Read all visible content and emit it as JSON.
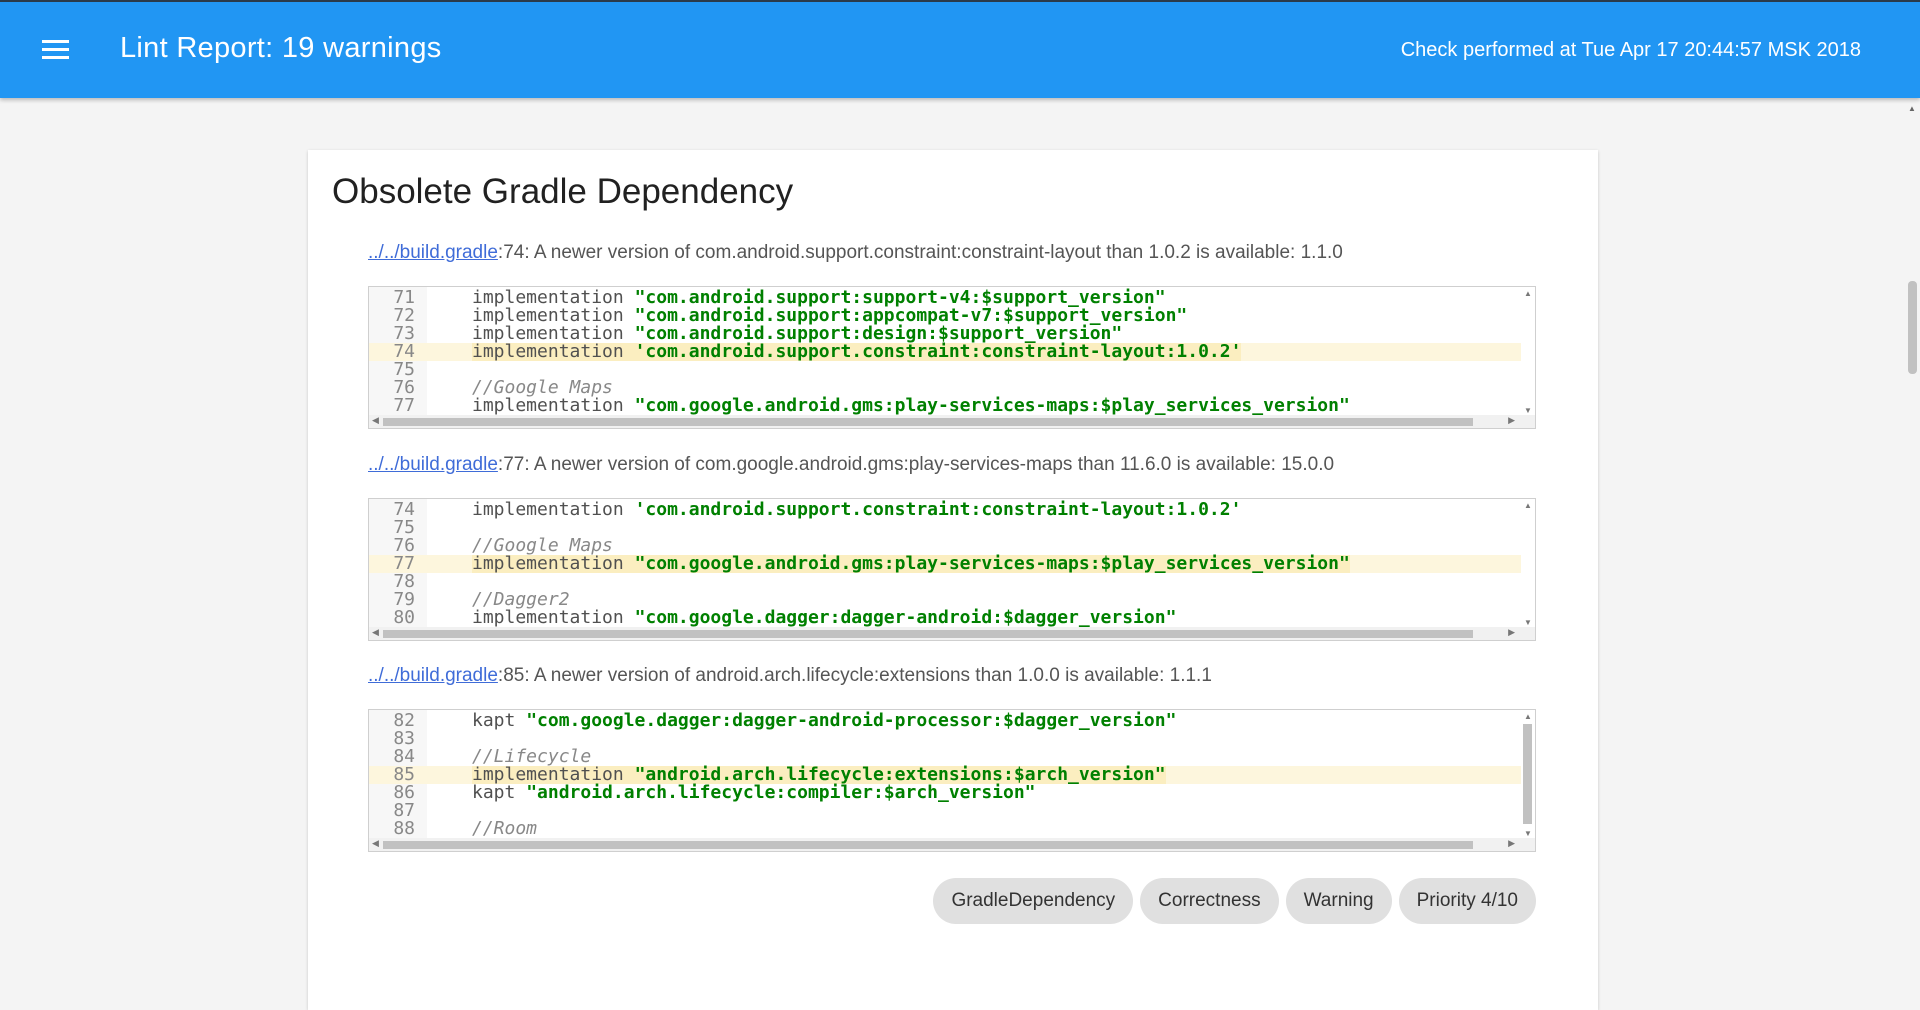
{
  "header": {
    "title": "Lint Report: 19 warnings",
    "check_time": "Check performed at Tue Apr 17 20:44:57 MSK 2018"
  },
  "issue": {
    "title": "Obsolete Gradle Dependency",
    "warnings": [
      {
        "file": "../../build.gradle",
        "message": ":74: A newer version of com.android.support.constraint:constraint-layout than 1.0.2 is available: 1.1.0",
        "lines": [
          {
            "num": "71",
            "hl": false,
            "kw": "implementation ",
            "str": "\"com.android.support:support-v4:$support_version\"",
            "cmt": ""
          },
          {
            "num": "72",
            "hl": false,
            "kw": "implementation ",
            "str": "\"com.android.support:appcompat-v7:$support_version\"",
            "cmt": ""
          },
          {
            "num": "73",
            "hl": false,
            "kw": "implementation ",
            "str": "\"com.android.support:design:$support_version\"",
            "cmt": ""
          },
          {
            "num": "74",
            "hl": true,
            "kw": "implementation ",
            "str": "'com.android.support.constraint:constraint-layout:1.0.2'",
            "cmt": ""
          },
          {
            "num": "75",
            "hl": false,
            "kw": "",
            "str": "",
            "cmt": ""
          },
          {
            "num": "76",
            "hl": false,
            "kw": "",
            "str": "",
            "cmt": "//Google Maps"
          },
          {
            "num": "77",
            "hl": false,
            "kw": "implementation ",
            "str": "\"com.google.android.gms:play-services-maps:$play_services_version\"",
            "cmt": ""
          }
        ]
      },
      {
        "file": "../../build.gradle",
        "message": ":77: A newer version of com.google.android.gms:play-services-maps than 11.6.0 is available: 15.0.0",
        "lines": [
          {
            "num": "74",
            "hl": false,
            "kw": "implementation ",
            "str": "'com.android.support.constraint:constraint-layout:1.0.2'",
            "cmt": ""
          },
          {
            "num": "75",
            "hl": false,
            "kw": "",
            "str": "",
            "cmt": ""
          },
          {
            "num": "76",
            "hl": false,
            "kw": "",
            "str": "",
            "cmt": "//Google Maps"
          },
          {
            "num": "77",
            "hl": true,
            "kw": "implementation ",
            "str": "\"com.google.android.gms:play-services-maps:$play_services_version\"",
            "cmt": ""
          },
          {
            "num": "78",
            "hl": false,
            "kw": "",
            "str": "",
            "cmt": ""
          },
          {
            "num": "79",
            "hl": false,
            "kw": "",
            "str": "",
            "cmt": "//Dagger2"
          },
          {
            "num": "80",
            "hl": false,
            "kw": "implementation ",
            "str": "\"com.google.dagger:dagger-android:$dagger_version\"",
            "cmt": ""
          }
        ]
      },
      {
        "file": "../../build.gradle",
        "message": ":85: A newer version of android.arch.lifecycle:extensions than 1.0.0 is available: 1.1.1",
        "lines": [
          {
            "num": "82",
            "hl": false,
            "kw": "kapt ",
            "str": "\"com.google.dagger:dagger-android-processor:$dagger_version\"",
            "cmt": ""
          },
          {
            "num": "83",
            "hl": false,
            "kw": "",
            "str": "",
            "cmt": ""
          },
          {
            "num": "84",
            "hl": false,
            "kw": "",
            "str": "",
            "cmt": "//Lifecycle"
          },
          {
            "num": "85",
            "hl": true,
            "kw": "implementation ",
            "str": "\"android.arch.lifecycle:extensions:$arch_version\"",
            "cmt": ""
          },
          {
            "num": "86",
            "hl": false,
            "kw": "kapt ",
            "str": "\"android.arch.lifecycle:compiler:$arch_version\"",
            "cmt": ""
          },
          {
            "num": "87",
            "hl": false,
            "kw": "",
            "str": "",
            "cmt": ""
          },
          {
            "num": "88",
            "hl": false,
            "kw": "",
            "str": "",
            "cmt": "//Room"
          }
        ]
      }
    ],
    "chips": [
      "GradleDependency",
      "Correctness",
      "Warning",
      "Priority 4/10"
    ]
  }
}
